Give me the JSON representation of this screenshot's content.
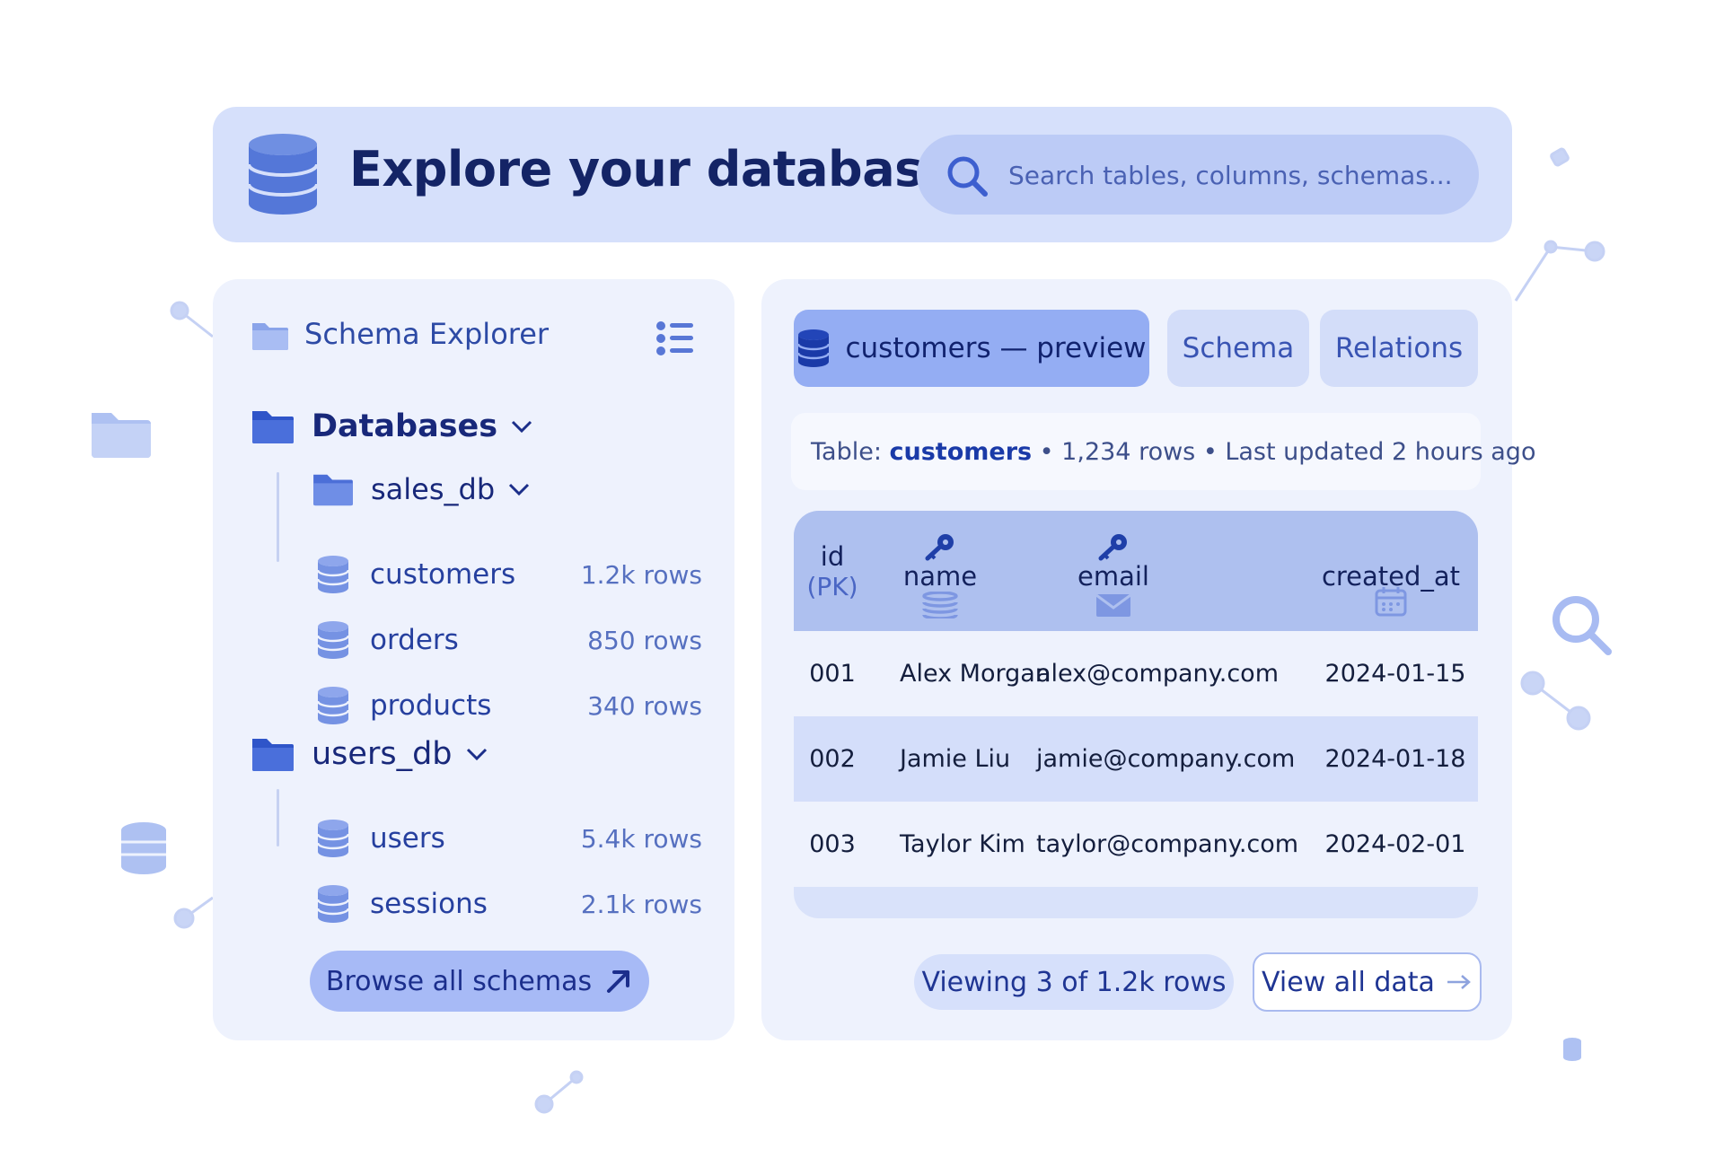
{
  "header": {
    "title": "Explore your databases",
    "search_placeholder": "Search tables, columns, schemas..."
  },
  "sidebar": {
    "title": "Schema Explorer",
    "databases_label": "Databases",
    "groups": [
      {
        "name": "sales_db",
        "tables": [
          {
            "name": "customers",
            "rows": "1.2k rows"
          },
          {
            "name": "orders",
            "rows": "850 rows"
          },
          {
            "name": "products",
            "rows": "340 rows"
          }
        ]
      },
      {
        "name": "users_db",
        "tables": [
          {
            "name": "users",
            "rows": "5.4k rows"
          },
          {
            "name": "sessions",
            "rows": "2.1k rows"
          }
        ]
      }
    ],
    "browse_label": "Browse all schemas"
  },
  "main": {
    "tabs": [
      {
        "label": "customers — preview",
        "active": true
      },
      {
        "label": "Schema",
        "active": false
      },
      {
        "label": "Relations",
        "active": false
      }
    ],
    "info": {
      "prefix": "Table: ",
      "table": "customers",
      "rest": " • 1,234 rows • Last updated 2 hours ago"
    },
    "columns": [
      {
        "label": "id",
        "sub": "(PK)",
        "icon": ""
      },
      {
        "label": "name",
        "sub": "",
        "icon": "key-icon"
      },
      {
        "label": "email",
        "sub": "",
        "icon": "key-icon"
      },
      {
        "label": "created_at",
        "sub": "",
        "icon": "calendar-icon"
      }
    ],
    "rows": [
      [
        "001",
        "Alex Morgan",
        "alex@company.com",
        "2024-01-15"
      ],
      [
        "002",
        "Jamie Liu",
        "jamie@company.com",
        "2024-01-18"
      ],
      [
        "003",
        "Taylor Kim",
        "taylor@company.com",
        "2024-02-01"
      ]
    ],
    "viewing_label": "Viewing 3 of 1.2k rows",
    "view_all_label": "View all data"
  },
  "colors": {
    "accent": "#94adf3",
    "header_bg": "#d6e0fb",
    "panel_bg": "#eef2fd",
    "text_dark": "#142466"
  }
}
